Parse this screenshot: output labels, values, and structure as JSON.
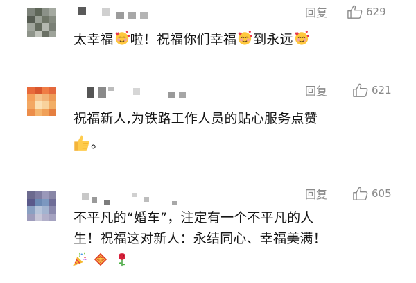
{
  "comments": [
    {
      "reply_label": "回复",
      "like_count": "629",
      "segments": [
        "太幸福",
        "啦！祝福你们幸福",
        "到永远"
      ]
    },
    {
      "reply_label": "回复",
      "like_count": "621",
      "line1": "祝福新人,为铁路工作人员的贴心服务点赞",
      "line2_suffix": "。"
    },
    {
      "reply_label": "回复",
      "like_count": "605",
      "line1": "不平凡的“婚车”，注定有一个不平凡的人",
      "line2": "生！祝福这对新人：永结同心、幸福美满！"
    }
  ],
  "icons": {
    "like": "thumbs-up-outline-icon",
    "emoji_hearts": "smiling-face-with-hearts-icon",
    "emoji_thumbs": "thumbs-up-emoji-icon",
    "emoji_party": "party-popper-icon",
    "emoji_fu": "fu-blessing-icon",
    "emoji_rose": "rose-icon"
  },
  "colors": {
    "text": "#151515",
    "meta": "#8a8a8a",
    "background": "#ffffff"
  }
}
